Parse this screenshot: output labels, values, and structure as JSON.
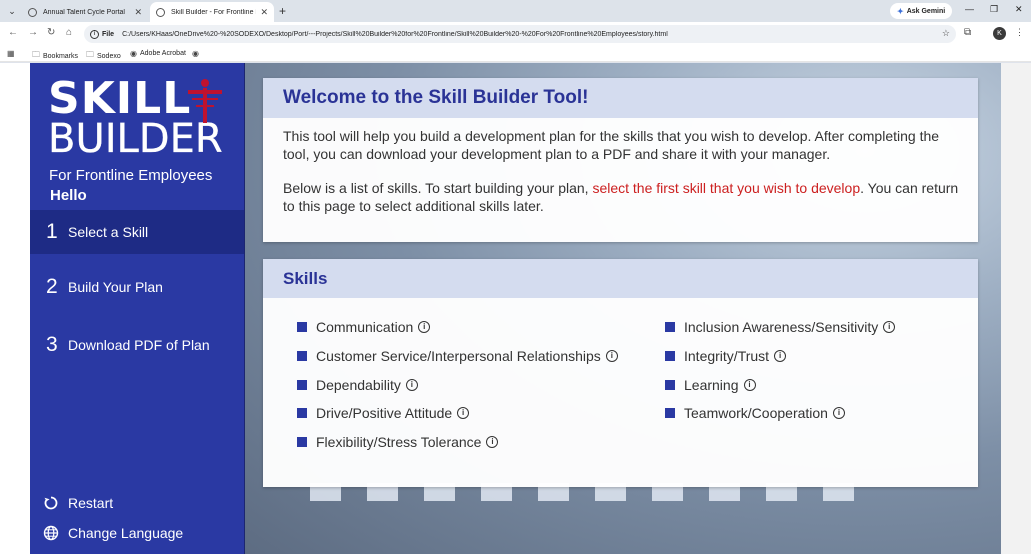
{
  "browser": {
    "tabs": [
      {
        "title": "Annual Talent Cycle Portal"
      },
      {
        "title": "Skill Builder - For Frontline Employees"
      }
    ],
    "new_tab": "+",
    "ask_gemini": "Ask Gemini",
    "address_scheme": "File",
    "url": "C:/Users/KHaas/OneDrive%20-%20SODEXO/Desktop/Port/---Projects/Skill%20Builder%20for%20Frontline/Skill%20Builder%20-%20For%20Frontline%20Employees/story.html",
    "profile_initial": "K",
    "bookmarks": [
      {
        "label": "Bookmarks"
      },
      {
        "label": "Sodexo"
      },
      {
        "label": "Adobe Acrobat"
      }
    ]
  },
  "sidebar": {
    "logo": {
      "line1": "SKILL",
      "line2": "BUILDER",
      "line3": "For Frontline Employees"
    },
    "greeting": "Hello",
    "steps": [
      {
        "number": "1",
        "label": "Select a Skill"
      },
      {
        "number": "2",
        "label": "Build Your Plan"
      },
      {
        "number": "3",
        "label": "Download PDF of Plan"
      }
    ],
    "restart_label": "Restart",
    "language_label": "Change Language"
  },
  "welcome": {
    "title": "Welcome to the Skill Builder Tool!",
    "para1": "This tool will help you build a development plan for the skills that you wish to develop.  After completing the tool, you can download your development plan to a PDF and share it with your manager.",
    "para2_before": "Below is a list of skills.  To start building your plan, ",
    "para2_highlight": "select the first skill that you wish to develop",
    "para2_after": ".  You can return to this page to select additional skills later."
  },
  "skills": {
    "title": "Skills",
    "left": [
      "Communication",
      "Customer Service/Interpersonal Relationships",
      "Dependability",
      "Drive/Positive Attitude",
      "Flexibility/Stress Tolerance"
    ],
    "right": [
      "Inclusion Awareness/Sensitivity",
      "Integrity/Trust",
      "Learning",
      "Teamwork/Cooperation"
    ]
  },
  "colors": {
    "sidebar": "#2a39a3",
    "sidebar_active": "#1e2b85",
    "heading": "#2a3396",
    "highlight": "#cc1f1f",
    "logo_accent": "#c0122f"
  },
  "icons": {
    "info": "info-circle-icon",
    "restart": "restart-icon",
    "language": "globe-icon"
  }
}
